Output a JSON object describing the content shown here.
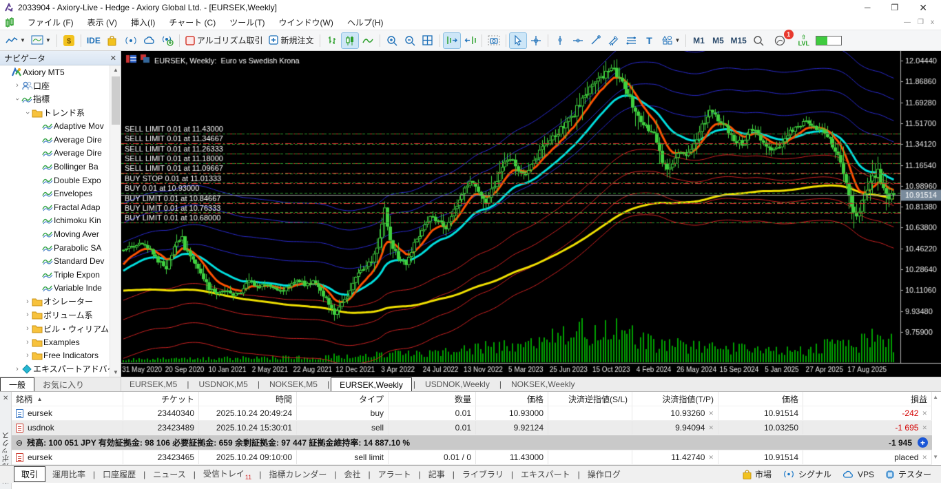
{
  "window": {
    "title": "2033904 - Axiory-Live - Hedge - Axiory Global Ltd. - [EURSEK,Weekly]",
    "minimize": "─",
    "maximize": "❐",
    "close": "✕",
    "mini_minimize": "—",
    "mini_restore": "❐",
    "mini_close": "x"
  },
  "menu": {
    "items": [
      "ファイル (F)",
      "表示 (V)",
      "挿入(I)",
      "チャート (C)",
      "ツール(T)",
      "ウインドウ(W)",
      "ヘルプ(H)"
    ]
  },
  "toolbar": {
    "ide_label": "IDE",
    "algo_label": "アルゴリズム取引",
    "new_order_label": "新規注文",
    "timeframes": [
      "M1",
      "M5",
      "M15"
    ],
    "lvl_label": "LVL",
    "bell_badge": "1"
  },
  "navigator": {
    "title": "ナビゲータ",
    "close_glyph": "✕",
    "tabs": [
      "一般",
      "お気に入り"
    ],
    "active_tab": "一般",
    "tree": [
      {
        "label": "Axiory MT5",
        "depth": 0,
        "icon": "logo",
        "arrow": ""
      },
      {
        "label": "口座",
        "depth": 1,
        "icon": "users",
        "arrow": "right"
      },
      {
        "label": "指標",
        "depth": 1,
        "icon": "indicator",
        "arrow": "down"
      },
      {
        "label": "トレンド系",
        "depth": 2,
        "icon": "folder",
        "arrow": "down"
      },
      {
        "label": "Adaptive Mov",
        "depth": 3,
        "icon": "indicator",
        "arrow": ""
      },
      {
        "label": "Average Dire",
        "depth": 3,
        "icon": "indicator",
        "arrow": ""
      },
      {
        "label": "Average Dire",
        "depth": 3,
        "icon": "indicator",
        "arrow": ""
      },
      {
        "label": "Bollinger Ba",
        "depth": 3,
        "icon": "indicator",
        "arrow": ""
      },
      {
        "label": "Double Expo",
        "depth": 3,
        "icon": "indicator",
        "arrow": ""
      },
      {
        "label": "Envelopes",
        "depth": 3,
        "icon": "indicator",
        "arrow": ""
      },
      {
        "label": "Fractal Adap",
        "depth": 3,
        "icon": "indicator",
        "arrow": ""
      },
      {
        "label": "Ichimoku Kin",
        "depth": 3,
        "icon": "indicator",
        "arrow": ""
      },
      {
        "label": "Moving Aver",
        "depth": 3,
        "icon": "indicator",
        "arrow": ""
      },
      {
        "label": "Parabolic SA",
        "depth": 3,
        "icon": "indicator",
        "arrow": ""
      },
      {
        "label": "Standard Dev",
        "depth": 3,
        "icon": "indicator",
        "arrow": ""
      },
      {
        "label": "Triple Expon",
        "depth": 3,
        "icon": "indicator",
        "arrow": ""
      },
      {
        "label": "Variable Inde",
        "depth": 3,
        "icon": "indicator",
        "arrow": ""
      },
      {
        "label": "オシレーター",
        "depth": 2,
        "icon": "folder",
        "arrow": "right"
      },
      {
        "label": "ボリューム系",
        "depth": 2,
        "icon": "folder",
        "arrow": "right"
      },
      {
        "label": "ビル・ウィリアムズ系",
        "depth": 2,
        "icon": "folder",
        "arrow": "right"
      },
      {
        "label": "Examples",
        "depth": 2,
        "icon": "folder",
        "arrow": "right"
      },
      {
        "label": "Free Indicators",
        "depth": 2,
        "icon": "folder",
        "arrow": "right"
      },
      {
        "label": "エキスパートアドバイザ",
        "depth": 1,
        "icon": "expert",
        "arrow": "right"
      }
    ]
  },
  "chart_tabs": {
    "items": [
      "EURSEK,M5",
      "USDNOK,M5",
      "NOKSEK,M5",
      "EURSEK,Weekly",
      "USDNOK,Weekly",
      "NOKSEK,Weekly"
    ],
    "active": "EURSEK,Weekly"
  },
  "chart_data": {
    "type": "candlestick",
    "title": "EURSEK, Weekly:  Euro vs Swedish Krona",
    "symbol": "EURSEK",
    "timeframe": "Weekly",
    "current_price": "10.91514",
    "y_ticks": [
      "12.04440",
      "11.86860",
      "11.69280",
      "11.51700",
      "11.34120",
      "11.16540",
      "10.98960",
      "10.81380",
      "10.63800",
      "10.46220",
      "10.28640",
      "10.11060",
      "9.93480",
      "9.75900"
    ],
    "x_ticks": [
      {
        "week": 7,
        "label": "31 May 2020"
      },
      {
        "week": 23,
        "label": "20 Sep 2020"
      },
      {
        "week": 39,
        "label": "10 Jan 2021"
      },
      {
        "week": 55,
        "label": "2 May 2021"
      },
      {
        "week": 71,
        "label": "22 Aug 2021"
      },
      {
        "week": 87,
        "label": "12 Dec 2021"
      },
      {
        "week": 103,
        "label": "3 Apr 2022"
      },
      {
        "week": 119,
        "label": "24 Jul 2022"
      },
      {
        "week": 135,
        "label": "13 Nov 2022"
      },
      {
        "week": 151,
        "label": "5 Mar 2023"
      },
      {
        "week": 167,
        "label": "25 Jun 2023"
      },
      {
        "week": 183,
        "label": "15 Oct 2023"
      },
      {
        "week": 199,
        "label": "4 Feb 2024"
      },
      {
        "week": 215,
        "label": "26 May 2024"
      },
      {
        "week": 231,
        "label": "15 Sep 2024"
      },
      {
        "week": 247,
        "label": "5 Jan 2025"
      },
      {
        "week": 263,
        "label": "27 Apr 2025"
      },
      {
        "week": 279,
        "label": "17 Aug 2025"
      }
    ],
    "orders": [
      {
        "label": "SELL LIMIT 0.01 at 11.43000",
        "price": 11.43,
        "side": "sell"
      },
      {
        "label": "SELL LIMIT 0.01 at 11.34667",
        "price": 11.34667,
        "side": "sell"
      },
      {
        "label": "SELL LIMIT 0.01 at 11.26333",
        "price": 11.26333,
        "side": "sell"
      },
      {
        "label": "SELL LIMIT 0.01 at 11.18000",
        "price": 11.18,
        "side": "sell"
      },
      {
        "label": "SELL LIMIT 0.01 at 11.09667",
        "price": 11.09667,
        "side": "sell"
      },
      {
        "label": "BUY STOP 0.01 at 11.01333",
        "price": 11.01333,
        "side": "buy"
      },
      {
        "label": "BUY 0.01 at 10.93000",
        "price": 10.93,
        "side": "position"
      },
      {
        "label": "BUY LIMIT 0.01 at 10.84667",
        "price": 10.84667,
        "side": "buy"
      },
      {
        "label": "BUY LIMIT 0.01 at 10.76333",
        "price": 10.76333,
        "side": "buy"
      },
      {
        "label": "BUY LIMIT 0.01 at 10.68000",
        "price": 10.68,
        "side": "buy"
      }
    ],
    "price_path": [
      [
        0,
        10.46
      ],
      [
        7,
        10.5
      ],
      [
        10,
        10.44
      ],
      [
        13,
        10.36
      ],
      [
        16,
        10.3
      ],
      [
        19,
        10.48
      ],
      [
        22,
        10.56
      ],
      [
        23,
        10.45
      ],
      [
        26,
        10.38
      ],
      [
        29,
        10.25
      ],
      [
        32,
        10.12
      ],
      [
        35,
        10.08
      ],
      [
        38,
        10.12
      ],
      [
        41,
        10.06
      ],
      [
        44,
        10.1
      ],
      [
        47,
        10.2
      ],
      [
        50,
        10.14
      ],
      [
        53,
        10.16
      ],
      [
        56,
        10.12
      ],
      [
        59,
        10.1
      ],
      [
        62,
        10.14
      ],
      [
        65,
        10.2
      ],
      [
        68,
        10.16
      ],
      [
        71,
        10.18
      ],
      [
        74,
        10.1
      ],
      [
        77,
        10.0
      ],
      [
        79,
        9.92
      ],
      [
        81,
        9.98
      ],
      [
        84,
        10.05
      ],
      [
        87,
        10.24
      ],
      [
        90,
        10.3
      ],
      [
        93,
        10.35
      ],
      [
        96,
        10.55
      ],
      [
        98,
        10.8
      ],
      [
        100,
        10.52
      ],
      [
        103,
        10.38
      ],
      [
        106,
        10.34
      ],
      [
        109,
        10.5
      ],
      [
        112,
        10.62
      ],
      [
        115,
        10.72
      ],
      [
        118,
        10.7
      ],
      [
        121,
        10.62
      ],
      [
        124,
        10.78
      ],
      [
        127,
        10.92
      ],
      [
        130,
        11.02
      ],
      [
        133,
        10.95
      ],
      [
        136,
        10.85
      ],
      [
        139,
        11.0
      ],
      [
        142,
        11.15
      ],
      [
        145,
        11.22
      ],
      [
        148,
        11.12
      ],
      [
        151,
        11.08
      ],
      [
        154,
        11.22
      ],
      [
        157,
        11.3
      ],
      [
        160,
        11.38
      ],
      [
        163,
        11.44
      ],
      [
        166,
        11.52
      ],
      [
        169,
        11.6
      ],
      [
        172,
        11.72
      ],
      [
        175,
        11.8
      ],
      [
        178,
        11.88
      ],
      [
        181,
        11.94
      ],
      [
        184,
        11.96
      ],
      [
        187,
        11.88
      ],
      [
        190,
        11.72
      ],
      [
        193,
        11.58
      ],
      [
        196,
        11.5
      ],
      [
        199,
        11.42
      ],
      [
        202,
        11.2
      ],
      [
        205,
        11.12
      ],
      [
        208,
        11.28
      ],
      [
        211,
        11.25
      ],
      [
        214,
        11.35
      ],
      [
        217,
        11.5
      ],
      [
        220,
        11.62
      ],
      [
        223,
        11.55
      ],
      [
        226,
        11.48
      ],
      [
        229,
        11.38
      ],
      [
        232,
        11.35
      ],
      [
        235,
        11.48
      ],
      [
        238,
        11.42
      ],
      [
        241,
        11.32
      ],
      [
        244,
        11.28
      ],
      [
        247,
        11.36
      ],
      [
        250,
        11.44
      ],
      [
        253,
        11.5
      ],
      [
        256,
        11.52
      ],
      [
        259,
        11.48
      ],
      [
        262,
        11.46
      ],
      [
        265,
        11.38
      ],
      [
        268,
        11.25
      ],
      [
        271,
        11.02
      ],
      [
        273,
        10.82
      ],
      [
        275,
        10.72
      ],
      [
        277,
        10.85
      ],
      [
        279,
        10.95
      ],
      [
        281,
        11.05
      ],
      [
        283,
        11.12
      ],
      [
        285,
        10.98
      ],
      [
        287,
        10.9
      ],
      [
        289,
        10.915
      ]
    ],
    "volume_profile": [
      [
        0,
        0.08
      ],
      [
        30,
        0.1
      ],
      [
        60,
        0.13
      ],
      [
        90,
        0.18
      ],
      [
        110,
        0.25
      ],
      [
        130,
        0.35
      ],
      [
        150,
        0.5
      ],
      [
        165,
        0.7
      ],
      [
        178,
        1.0
      ],
      [
        188,
        0.75
      ],
      [
        200,
        0.5
      ],
      [
        215,
        0.42
      ],
      [
        230,
        0.38
      ],
      [
        245,
        0.32
      ],
      [
        258,
        0.35
      ],
      [
        268,
        0.5
      ],
      [
        275,
        0.45
      ],
      [
        283,
        0.95
      ],
      [
        289,
        0.5
      ]
    ],
    "indicators": {
      "ma_fast": {
        "period": 10,
        "color": "#ff5000",
        "width": 3
      },
      "ma_mid": {
        "period": 26,
        "color": "#00dede",
        "width": 3
      },
      "ma_slow": {
        "period": 120,
        "scale": 0.97,
        "color": "#f0e000",
        "width": 3
      },
      "base_period": 60,
      "upper_envelopes": {
        "color": "#2a2ace",
        "offsets": [
          0.016,
          0.032,
          0.048,
          0.064
        ]
      },
      "lower_envelopes": {
        "color": "#cc2222",
        "offsets": [
          -0.016,
          -0.032,
          -0.048,
          -0.064
        ]
      },
      "tp_gap": 0.0026
    },
    "colors": {
      "bull": "#3fd03f",
      "volume": "#00a000",
      "order_line": "#e03030",
      "tp_line": "#2e9e2e",
      "current_line": "#9a9a9a",
      "price_box": "#7a8b9c",
      "axis_text": "#e8e8e8",
      "axis_line": "#b0b0b0"
    }
  },
  "toolbox": {
    "vertical_label": "ツールボックス",
    "close_glyph": "✕",
    "columns": [
      "銘柄",
      "チケット",
      "時間",
      "タイプ",
      "数量",
      "価格",
      "決済逆指値(S/L)",
      "決済指値(T/P)",
      "価格",
      "損益"
    ],
    "sort_arrow": "▲",
    "rows": [
      {
        "icon": "blue",
        "cells": [
          "eursek",
          "23440340",
          "2025.10.24 20:49:24",
          "buy",
          "0.01",
          "10.93000",
          "",
          "10.93260",
          "10.91514",
          "-242"
        ],
        "profit_negative": true,
        "zebra": false
      },
      {
        "icon": "red",
        "cells": [
          "usdnok",
          "23423489",
          "2025.10.24 15:30:01",
          "sell",
          "0.01",
          "9.92124",
          "",
          "9.94094",
          "10.03250",
          "-1 695"
        ],
        "profit_negative": true,
        "zebra": true
      }
    ],
    "pending_rows": [
      {
        "icon": "red",
        "cells": [
          "eursek",
          "23423465",
          "2025.10.24 09:10:00",
          "sell limit",
          "0.01 / 0",
          "11.43000",
          "",
          "11.42740",
          "10.91514",
          "placed"
        ],
        "profit_negative": false,
        "zebra": false
      }
    ],
    "balance_row": {
      "text": "残高: 100 051 JPY  有効証拠金: 98 106  必要証拠金: 659  余剰証拠金: 97 447  証拠金維持率: 14 887.10 %",
      "profit": "-1 945"
    },
    "tabs": [
      "取引",
      "運用比率",
      "口座履歴",
      "ニュース",
      "受信トレイ",
      "指標カレンダー",
      "会社",
      "アラート",
      "記事",
      "ライブラリ",
      "エキスパート",
      "操作ログ"
    ],
    "active_tab": "取引",
    "inbox_badge": "11",
    "status_items": [
      {
        "icon": "bag",
        "label": "市場"
      },
      {
        "icon": "signal",
        "label": "シグナル"
      },
      {
        "icon": "cloud",
        "label": "VPS"
      },
      {
        "icon": "chip",
        "label": "テスター"
      }
    ]
  }
}
